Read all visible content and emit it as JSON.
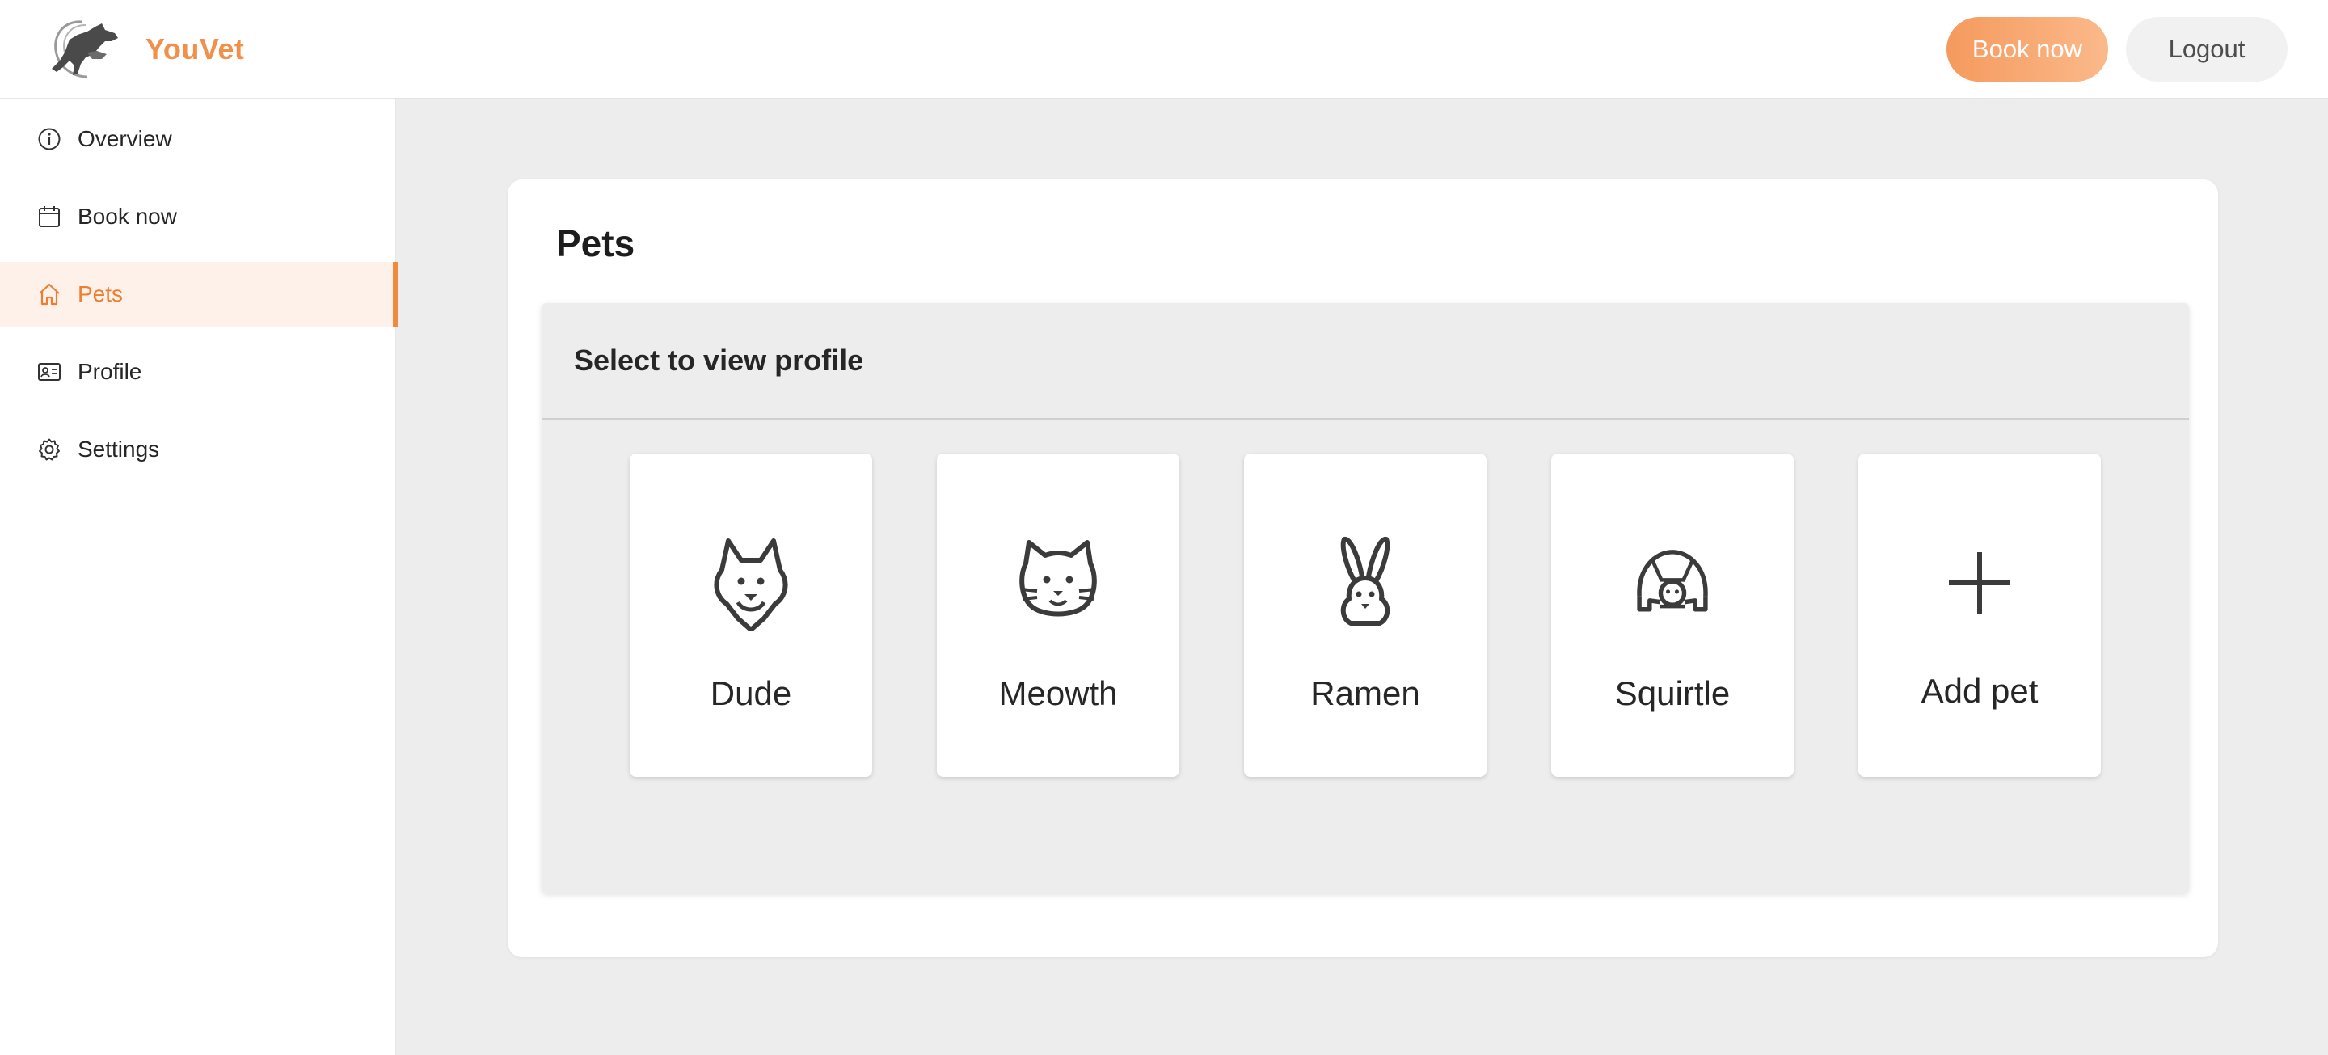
{
  "header": {
    "brand_name": "YouVet",
    "book_now_label": "Book now",
    "logout_label": "Logout",
    "brand_color": "#f0904a"
  },
  "sidebar": {
    "items": [
      {
        "label": "Overview",
        "icon": "info-icon",
        "active": false
      },
      {
        "label": "Book now",
        "icon": "calendar-icon",
        "active": false
      },
      {
        "label": "Pets",
        "icon": "home-icon",
        "active": true
      },
      {
        "label": "Profile",
        "icon": "id-card-icon",
        "active": false
      },
      {
        "label": "Settings",
        "icon": "gear-icon",
        "active": false
      }
    ],
    "active_color": "#ee7e2f"
  },
  "main": {
    "title": "Pets",
    "panel_title": "Select to view profile",
    "pets": [
      {
        "name": "Dude",
        "icon": "dog-icon"
      },
      {
        "name": "Meowth",
        "icon": "cat-icon"
      },
      {
        "name": "Ramen",
        "icon": "rabbit-icon"
      },
      {
        "name": "Squirtle",
        "icon": "turtle-icon"
      }
    ],
    "add_pet_label": "Add pet"
  }
}
